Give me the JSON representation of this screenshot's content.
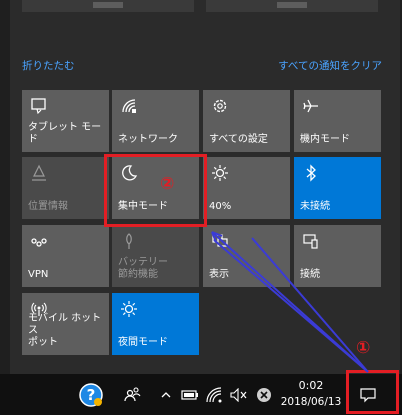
{
  "action_center": {
    "collapse_label": "折りたたむ",
    "clear_all_label": "すべての通知をクリア",
    "tiles": [
      {
        "label": "タブレット モード",
        "icon": "tablet-mode-icon",
        "state": "off"
      },
      {
        "label": "ネットワーク",
        "icon": "network-icon",
        "state": "off"
      },
      {
        "label": "すべての設定",
        "icon": "gear-icon",
        "state": "off"
      },
      {
        "label": "機内モード",
        "icon": "airplane-icon",
        "state": "off"
      },
      {
        "label": "位置情報",
        "icon": "location-icon",
        "state": "disabled"
      },
      {
        "label": "集中モード",
        "icon": "moon-icon",
        "state": "off"
      },
      {
        "label": "40%",
        "icon": "brightness-icon",
        "state": "off"
      },
      {
        "label": "未接続",
        "icon": "bluetooth-icon",
        "state": "on"
      },
      {
        "label": "VPN",
        "icon": "vpn-icon",
        "state": "off"
      },
      {
        "label": "バッテリー\n節約機能",
        "icon": "battery-saver-icon",
        "state": "disabled"
      },
      {
        "label": "表示",
        "icon": "display-icon",
        "state": "off"
      },
      {
        "label": "接続",
        "icon": "connect-icon",
        "state": "off"
      },
      {
        "label": "モバイル ホットス\nポット",
        "icon": "mobile-hotspot-icon",
        "state": "off"
      },
      {
        "label": "夜間モード",
        "icon": "night-light-icon",
        "state": "on"
      }
    ]
  },
  "taskbar": {
    "time": "0:02",
    "date": "2018/06/13"
  },
  "annotations": {
    "marker_1": "①",
    "marker_2": "②"
  },
  "colors": {
    "accent": "#0078d7",
    "tile": "#5e5e5e",
    "link": "#4aa3ff",
    "annotation_red": "#e31e24",
    "annotation_arrow": "#3b3bd6"
  }
}
